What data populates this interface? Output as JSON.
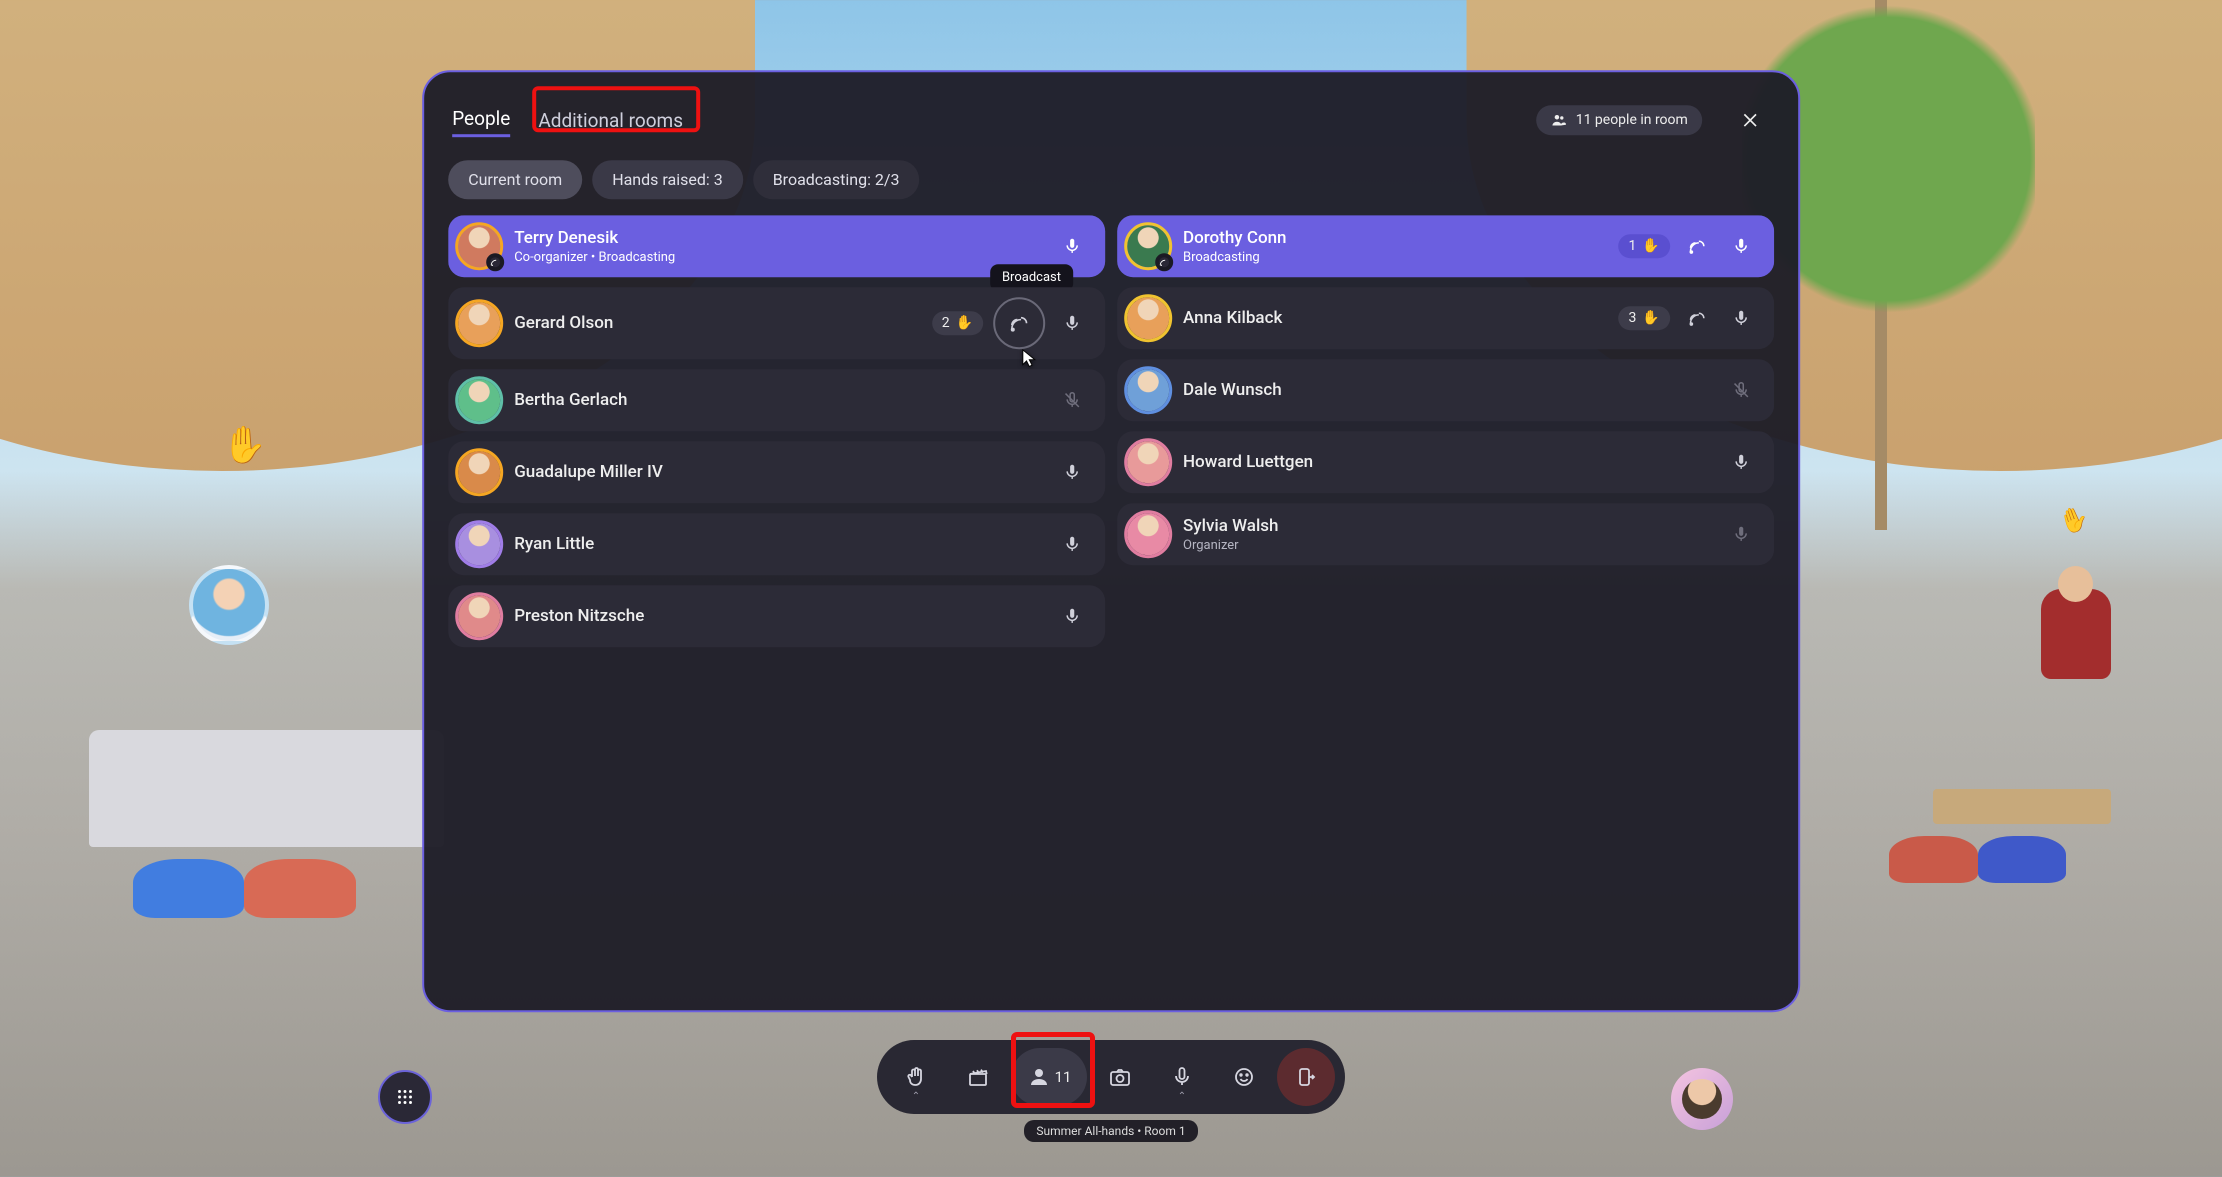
{
  "header": {
    "tabs": {
      "people": "People",
      "additional_rooms": "Additional rooms"
    },
    "room_count_label": "11 people in room"
  },
  "chips": {
    "current_room": "Current room",
    "hands_raised": "Hands raised: 3",
    "broadcasting": "Broadcasting: 2/3"
  },
  "tooltip_broadcast": "Broadcast",
  "left": [
    {
      "name": "Terry Denesik",
      "sub": "Co-organizer • Broadcasting",
      "highlight": true,
      "role_badge": true,
      "mic": "on",
      "avatar_bg": "#d07a5f",
      "ring": "ring-orange"
    },
    {
      "name": "Gerard Olson",
      "hand": "2",
      "broadcast_btn": true,
      "mic": "on",
      "avatar_bg": "#e8a05a",
      "ring": "ring-orange"
    },
    {
      "name": "Bertha Gerlach",
      "mic": "muted",
      "avatar_bg": "#5fbf8a",
      "ring": "ring-teal"
    },
    {
      "name": "Guadalupe Miller IV",
      "mic": "on",
      "avatar_bg": "#d98a4a",
      "ring": "ring-orange"
    },
    {
      "name": "Ryan Little",
      "mic": "on",
      "avatar_bg": "#a88fe0",
      "ring": "ring-purple"
    },
    {
      "name": "Preston Nitzsche",
      "mic": "on",
      "avatar_bg": "#e08a8a",
      "ring": "ring-pink"
    }
  ],
  "right": [
    {
      "name": "Dorothy Conn",
      "sub": "Broadcasting",
      "highlight": true,
      "role_badge": true,
      "hand": "1",
      "cast": true,
      "mic": "on",
      "avatar_bg": "#3a7a4f",
      "ring": "ring-yellow"
    },
    {
      "name": "Anna Kilback",
      "hand": "3",
      "cast": true,
      "mic": "on",
      "avatar_bg": "#e8a05a",
      "ring": "ring-yellow"
    },
    {
      "name": "Dale Wunsch",
      "mic": "muted",
      "avatar_bg": "#6fa0d8",
      "ring": "ring-blue"
    },
    {
      "name": "Howard Luettgen",
      "mic": "on",
      "avatar_bg": "#e89a9a",
      "ring": "ring-pink"
    },
    {
      "name": "Sylvia Walsh",
      "sub": "Organizer",
      "mic": "dim",
      "avatar_bg": "#e88aa5",
      "ring": "ring-pink"
    }
  ],
  "actionbar": {
    "people_count": "11"
  },
  "room_label": "Summer All-hands • Room 1"
}
